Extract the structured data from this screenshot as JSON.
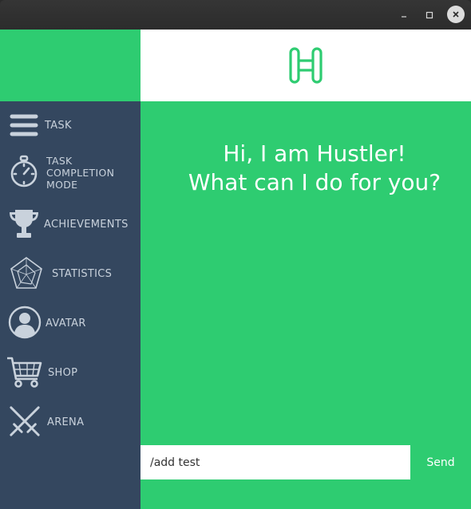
{
  "window": {
    "minimize_icon": "minimize-icon",
    "maximize_icon": "maximize-icon",
    "close_icon": "close-icon"
  },
  "header": {
    "logo_icon": "hustler-h-logo",
    "accent_color": "#2ecc71"
  },
  "sidebar": {
    "background": "#34475f",
    "items": [
      {
        "label": "TASK",
        "icon": "menu-icon"
      },
      {
        "label": "TASK\nCOMPLETION\nMODE",
        "icon": "stopwatch-icon"
      },
      {
        "label": "ACHIEVEMENTS",
        "icon": "trophy-icon"
      },
      {
        "label": "STATISTICS",
        "icon": "statistics-icon"
      },
      {
        "label": "AVATAR",
        "icon": "avatar-icon"
      },
      {
        "label": "SHOP",
        "icon": "cart-icon"
      },
      {
        "label": "ARENA",
        "icon": "swords-icon"
      }
    ]
  },
  "main": {
    "greeting": "Hi, I am Hustler!\nWhat can I do for you?"
  },
  "command": {
    "value": "/add test",
    "send_label": "Send"
  }
}
